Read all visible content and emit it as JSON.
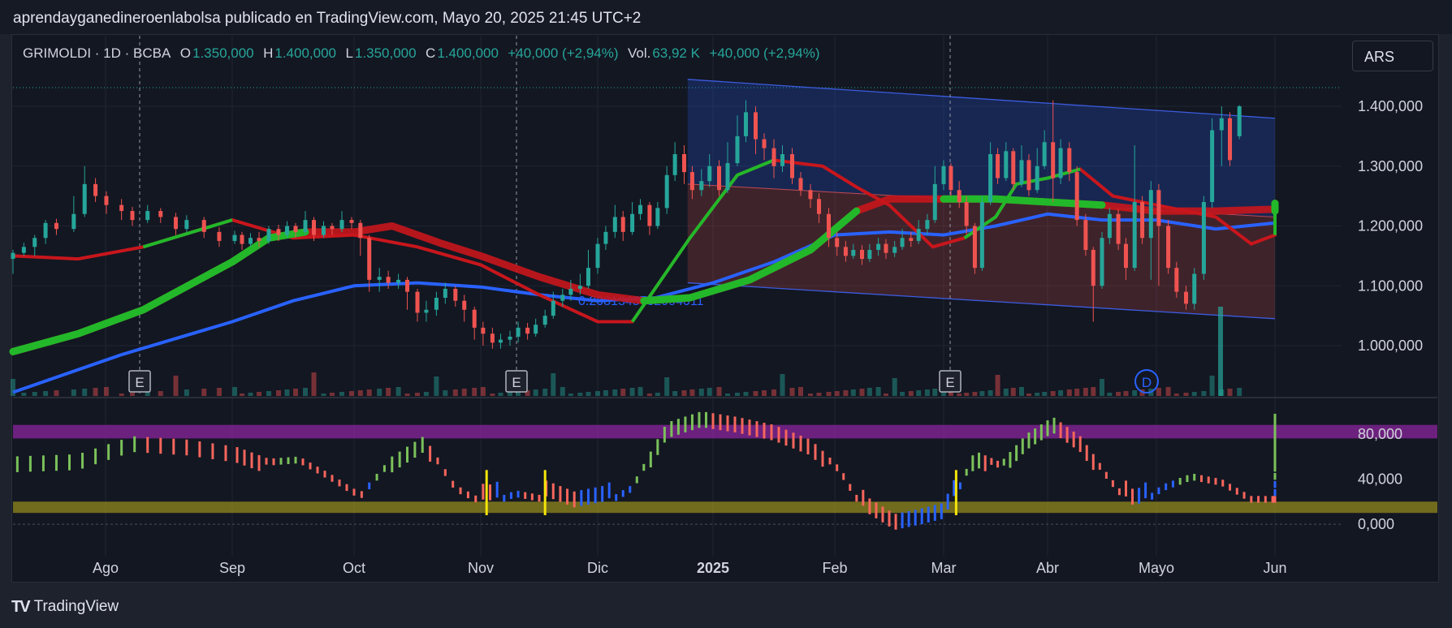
{
  "header": {
    "publisher_line": "aprendayganedineroenlabolsa publicado en TradingView.com, Mayo 20, 2025 21:45 UTC+2"
  },
  "legend": {
    "symbol": "GRIMOLDI · 1D · BCBA",
    "open_label": "O",
    "open": "1.350,000",
    "high_label": "H",
    "high": "1.400,000",
    "low_label": "L",
    "low": "1.350,000",
    "close_label": "C",
    "close": "1.400,000",
    "change": "+40,000 (+2,94%)",
    "vol_label": "Vol.",
    "vol": "63,92 K",
    "vol_change": "+40,000 (+2,94%)"
  },
  "currency_button": "ARS",
  "channel_label": "0.2081345732994011",
  "event_markers": [
    "E",
    "E",
    "E",
    "D"
  ],
  "footer": {
    "brand": "TradingView"
  },
  "colors": {
    "up": "#26a69a",
    "down": "#ef5350",
    "ma_blue": "#2962ff",
    "ma_green": "#22b82a",
    "ma_red": "#c8161c",
    "osc_blue": "#2962ff",
    "osc_red": "#f7665c",
    "osc_green": "#7bc15a",
    "band_purple": "#9c27b0",
    "band_yellow": "#b0a31b"
  },
  "chart_data": [
    {
      "type": "candlestick",
      "title": "GRIMOLDI · 1D · BCBA",
      "x_tick_labels": [
        "Ago",
        "Sep",
        "Oct",
        "Nov",
        "Dic",
        "2025",
        "Feb",
        "Mar",
        "Abr",
        "Mayo",
        "Jun"
      ],
      "y_tick_labels": [
        "1.400,000",
        "1.300,000",
        "1.200,000",
        "1.100,000",
        "1.000,000"
      ],
      "y_ticks": [
        1400,
        1300,
        1200,
        1100,
        1000
      ],
      "ylim": [
        920,
        1480
      ],
      "last_close": 1400,
      "channel_upper": [
        [
          4.78,
          1445
        ],
        [
          10.9,
          1380
        ]
      ],
      "channel_lower": [
        [
          4.78,
          1105
        ],
        [
          10.9,
          1045
        ]
      ],
      "channel_mid": [
        [
          4.78,
          1270
        ],
        [
          10.9,
          1215
        ]
      ],
      "ma_blue": [
        [
          0,
          922
        ],
        [
          0.5,
          985
        ],
        [
          1,
          1040
        ],
        [
          1.5,
          1075
        ],
        [
          2,
          1100
        ],
        [
          2.5,
          1105
        ],
        [
          3,
          1098
        ],
        [
          3.5,
          1085
        ],
        [
          4,
          1075
        ],
        [
          4.5,
          1080
        ],
        [
          5,
          1105
        ],
        [
          5.5,
          1140
        ],
        [
          6,
          1185
        ],
        [
          6.5,
          1190
        ],
        [
          7,
          1185
        ],
        [
          7.5,
          1200
        ],
        [
          8,
          1220
        ],
        [
          8.5,
          1210
        ],
        [
          9,
          1210
        ],
        [
          9.5,
          1195
        ],
        [
          10,
          1205
        ],
        [
          10.4,
          1210
        ],
        [
          10.9,
          1220
        ]
      ],
      "ma_fast": [
        [
          0,
          1150
        ],
        [
          0.3,
          1145
        ],
        [
          0.6,
          1165
        ],
        [
          1,
          1210
        ],
        [
          1.5,
          1180
        ],
        [
          2,
          1185
        ],
        [
          2.5,
          1165
        ],
        [
          3,
          1135
        ],
        [
          3.5,
          1085
        ],
        [
          4,
          1040
        ],
        [
          4.3,
          1040
        ],
        [
          4.8,
          1180
        ],
        [
          5.2,
          1285
        ],
        [
          5.5,
          1310
        ],
        [
          5.9,
          1300
        ],
        [
          6.2,
          1265
        ],
        [
          6.5,
          1235
        ],
        [
          6.9,
          1165
        ],
        [
          7.2,
          1180
        ],
        [
          7.5,
          1215
        ],
        [
          7.7,
          1270
        ],
        [
          8,
          1280
        ],
        [
          8.3,
          1295
        ],
        [
          8.6,
          1250
        ],
        [
          9,
          1235
        ],
        [
          9.5,
          1215
        ],
        [
          9.8,
          1170
        ],
        [
          10.2,
          1185
        ],
        [
          10.5,
          1240
        ],
        [
          10.9,
          1238
        ]
      ],
      "ma_slow_points": [
        [
          0,
          990
        ],
        [
          0.3,
          1020
        ],
        [
          0.6,
          1060
        ],
        [
          1,
          1140
        ],
        [
          1.3,
          1180
        ],
        [
          1.6,
          1190
        ],
        [
          2,
          1190
        ],
        [
          2.3,
          1200
        ],
        [
          2.7,
          1170
        ],
        [
          3,
          1150
        ],
        [
          3.5,
          1115
        ],
        [
          4,
          1085
        ],
        [
          4.4,
          1075
        ],
        [
          4.8,
          1080
        ],
        [
          5.3,
          1110
        ],
        [
          5.8,
          1160
        ],
        [
          6.2,
          1225
        ],
        [
          6.5,
          1245
        ],
        [
          7,
          1245
        ],
        [
          7.5,
          1245
        ],
        [
          8,
          1240
        ],
        [
          8.5,
          1235
        ],
        [
          9,
          1225
        ],
        [
          9.5,
          1225
        ],
        [
          10,
          1228
        ],
        [
          10.5,
          1225
        ],
        [
          10.9,
          1238
        ]
      ],
      "candles": [
        [
          0.0,
          1145,
          1155,
          1120,
          1160
        ],
        [
          0.05,
          1155,
          1165,
          1150,
          1172
        ],
        [
          0.1,
          1165,
          1180,
          1150,
          1185
        ],
        [
          0.15,
          1180,
          1205,
          1170,
          1210
        ],
        [
          0.2,
          1205,
          1195,
          1185,
          1212
        ],
        [
          0.28,
          1195,
          1220,
          1190,
          1250
        ],
        [
          0.33,
          1220,
          1270,
          1215,
          1300
        ],
        [
          0.38,
          1270,
          1250,
          1240,
          1280
        ],
        [
          0.43,
          1250,
          1235,
          1220,
          1258
        ],
        [
          0.5,
          1235,
          1225,
          1210,
          1245
        ],
        [
          0.55,
          1225,
          1210,
          1200,
          1232
        ],
        [
          0.62,
          1210,
          1225,
          1205,
          1235
        ],
        [
          0.68,
          1225,
          1215,
          1205,
          1230
        ],
        [
          0.75,
          1215,
          1195,
          1185,
          1222
        ],
        [
          0.8,
          1195,
          1210,
          1190,
          1218
        ],
        [
          0.88,
          1210,
          1190,
          1180,
          1215
        ],
        [
          0.95,
          1190,
          1175,
          1165,
          1198
        ],
        [
          1.02,
          1175,
          1185,
          1170,
          1192
        ],
        [
          1.08,
          1185,
          1170,
          1160,
          1190
        ],
        [
          1.15,
          1170,
          1180,
          1165,
          1188
        ],
        [
          1.22,
          1180,
          1175,
          1165,
          1190
        ],
        [
          1.3,
          1175,
          1195,
          1170,
          1200
        ],
        [
          1.38,
          1195,
          1185,
          1175,
          1202
        ],
        [
          1.45,
          1185,
          1200,
          1180,
          1208
        ],
        [
          1.52,
          1200,
          1190,
          1180,
          1205
        ],
        [
          1.6,
          1190,
          1210,
          1185,
          1225
        ],
        [
          1.67,
          1210,
          1185,
          1175,
          1215
        ],
        [
          1.75,
          1185,
          1200,
          1180,
          1208
        ],
        [
          1.82,
          1200,
          1195,
          1185,
          1205
        ],
        [
          1.9,
          1195,
          1210,
          1190,
          1225
        ],
        [
          1.98,
          1210,
          1205,
          1195,
          1215
        ],
        [
          2.05,
          1205,
          1180,
          1150,
          1210
        ],
        [
          2.12,
          1180,
          1110,
          1090,
          1185
        ],
        [
          2.2,
          1110,
          1115,
          1090,
          1130
        ],
        [
          2.27,
          1115,
          1105,
          1095,
          1125
        ],
        [
          2.35,
          1105,
          1110,
          1095,
          1120
        ],
        [
          2.42,
          1110,
          1090,
          1060,
          1115
        ],
        [
          2.5,
          1090,
          1055,
          1040,
          1095
        ],
        [
          2.57,
          1055,
          1060,
          1040,
          1075
        ],
        [
          2.65,
          1060,
          1080,
          1050,
          1090
        ],
        [
          2.72,
          1080,
          1095,
          1070,
          1105
        ],
        [
          2.8,
          1095,
          1075,
          1065,
          1100
        ],
        [
          2.87,
          1075,
          1060,
          1040,
          1085
        ],
        [
          2.95,
          1060,
          1030,
          1010,
          1065
        ],
        [
          3.02,
          1030,
          1020,
          1000,
          1040
        ],
        [
          3.1,
          1020,
          1005,
          995,
          1030
        ],
        [
          3.17,
          1005,
          1010,
          995,
          1020
        ],
        [
          3.25,
          1010,
          1015,
          1000,
          1025
        ],
        [
          3.32,
          1015,
          1030,
          1005,
          1040
        ],
        [
          3.4,
          1030,
          1020,
          1010,
          1038
        ],
        [
          3.47,
          1020,
          1035,
          1015,
          1045
        ],
        [
          3.55,
          1035,
          1050,
          1030,
          1060
        ],
        [
          3.62,
          1050,
          1075,
          1045,
          1090
        ],
        [
          3.7,
          1075,
          1085,
          1065,
          1095
        ],
        [
          3.77,
          1085,
          1095,
          1075,
          1110
        ],
        [
          3.85,
          1095,
          1100,
          1085,
          1120
        ],
        [
          3.92,
          1100,
          1130,
          1095,
          1160
        ],
        [
          4.0,
          1130,
          1170,
          1120,
          1180
        ],
        [
          4.07,
          1170,
          1190,
          1160,
          1200
        ],
        [
          4.15,
          1190,
          1215,
          1180,
          1235
        ],
        [
          4.22,
          1215,
          1190,
          1175,
          1225
        ],
        [
          4.3,
          1190,
          1220,
          1185,
          1240
        ],
        [
          4.37,
          1220,
          1235,
          1210,
          1245
        ],
        [
          4.45,
          1235,
          1200,
          1185,
          1240
        ],
        [
          4.52,
          1200,
          1230,
          1195,
          1240
        ],
        [
          4.6,
          1230,
          1285,
          1220,
          1300
        ],
        [
          4.67,
          1285,
          1320,
          1275,
          1340
        ],
        [
          4.75,
          1320,
          1290,
          1270,
          1335
        ],
        [
          4.82,
          1290,
          1260,
          1245,
          1300
        ],
        [
          4.9,
          1260,
          1275,
          1250,
          1295
        ],
        [
          4.97,
          1275,
          1300,
          1265,
          1320
        ],
        [
          5.05,
          1300,
          1260,
          1250,
          1310
        ],
        [
          5.12,
          1260,
          1305,
          1255,
          1340
        ],
        [
          5.2,
          1305,
          1350,
          1300,
          1385
        ],
        [
          5.27,
          1350,
          1390,
          1340,
          1410
        ],
        [
          5.35,
          1390,
          1345,
          1320,
          1400
        ],
        [
          5.42,
          1345,
          1330,
          1310,
          1355
        ],
        [
          5.5,
          1330,
          1300,
          1280,
          1345
        ],
        [
          5.57,
          1300,
          1320,
          1290,
          1335
        ],
        [
          5.65,
          1320,
          1280,
          1270,
          1330
        ],
        [
          5.72,
          1280,
          1260,
          1250,
          1290
        ],
        [
          5.8,
          1260,
          1245,
          1230,
          1270
        ],
        [
          5.87,
          1245,
          1220,
          1205,
          1255
        ],
        [
          5.95,
          1220,
          1180,
          1165,
          1230
        ],
        [
          6.02,
          1180,
          1165,
          1150,
          1190
        ],
        [
          6.1,
          1165,
          1150,
          1140,
          1175
        ],
        [
          6.17,
          1150,
          1160,
          1145,
          1170
        ],
        [
          6.25,
          1160,
          1145,
          1135,
          1168
        ],
        [
          6.32,
          1145,
          1160,
          1140,
          1170
        ],
        [
          6.4,
          1160,
          1170,
          1150,
          1180
        ],
        [
          6.47,
          1170,
          1155,
          1145,
          1178
        ],
        [
          6.55,
          1155,
          1165,
          1148,
          1175
        ],
        [
          6.62,
          1165,
          1180,
          1160,
          1195
        ],
        [
          6.7,
          1180,
          1175,
          1165,
          1190
        ],
        [
          6.77,
          1175,
          1195,
          1170,
          1210
        ],
        [
          6.85,
          1195,
          1210,
          1185,
          1220
        ],
        [
          6.92,
          1210,
          1270,
          1205,
          1300
        ],
        [
          7.0,
          1270,
          1300,
          1260,
          1310
        ],
        [
          7.07,
          1300,
          1260,
          1250,
          1305
        ],
        [
          7.15,
          1260,
          1240,
          1230,
          1275
        ],
        [
          7.22,
          1240,
          1200,
          1185,
          1250
        ],
        [
          7.3,
          1200,
          1130,
          1120,
          1205
        ],
        [
          7.37,
          1130,
          1240,
          1125,
          1250
        ],
        [
          7.45,
          1240,
          1320,
          1235,
          1340
        ],
        [
          7.52,
          1320,
          1280,
          1270,
          1330
        ],
        [
          7.6,
          1280,
          1325,
          1275,
          1340
        ],
        [
          7.67,
          1325,
          1270,
          1260,
          1330
        ],
        [
          7.75,
          1270,
          1310,
          1265,
          1335
        ],
        [
          7.82,
          1310,
          1260,
          1250,
          1320
        ],
        [
          7.9,
          1260,
          1300,
          1255,
          1330
        ],
        [
          7.97,
          1300,
          1340,
          1295,
          1360
        ],
        [
          8.05,
          1340,
          1280,
          1240,
          1410
        ],
        [
          8.12,
          1280,
          1330,
          1270,
          1345
        ],
        [
          8.2,
          1330,
          1290,
          1275,
          1340
        ],
        [
          8.27,
          1290,
          1210,
          1200,
          1300
        ],
        [
          8.35,
          1210,
          1160,
          1150,
          1220
        ],
        [
          8.42,
          1160,
          1100,
          1040,
          1165
        ],
        [
          8.5,
          1100,
          1180,
          1095,
          1190
        ],
        [
          8.57,
          1180,
          1220,
          1170,
          1230
        ],
        [
          8.65,
          1220,
          1170,
          1160,
          1228
        ],
        [
          8.72,
          1170,
          1130,
          1110,
          1180
        ],
        [
          8.8,
          1130,
          1240,
          1125,
          1335
        ],
        [
          8.87,
          1240,
          1180,
          1170,
          1250
        ],
        [
          8.95,
          1180,
          1260,
          1110,
          1275
        ],
        [
          9.02,
          1260,
          1200,
          1100,
          1270
        ],
        [
          9.1,
          1200,
          1130,
          1120,
          1210
        ],
        [
          9.17,
          1130,
          1090,
          1080,
          1140
        ],
        [
          9.25,
          1090,
          1070,
          1060,
          1100
        ],
        [
          9.32,
          1070,
          1120,
          1060,
          1130
        ],
        [
          9.4,
          1120,
          1240,
          1110,
          1250
        ],
        [
          9.47,
          1240,
          1360,
          1230,
          1380
        ],
        [
          9.55,
          1360,
          1380,
          1300,
          1400
        ],
        [
          9.62,
          1380,
          1310,
          1300,
          1390
        ],
        [
          9.7,
          1350,
          1400,
          1345,
          1402
        ]
      ]
    },
    {
      "type": "bar",
      "title": "oscillator",
      "y_tick_labels": [
        "80,000",
        "40,000",
        "0,000"
      ],
      "y_ticks": [
        80,
        40,
        0
      ],
      "ylim": [
        -10,
        105
      ],
      "bands": [
        [
          76,
          88
        ],
        [
          10,
          20
        ]
      ]
    }
  ]
}
